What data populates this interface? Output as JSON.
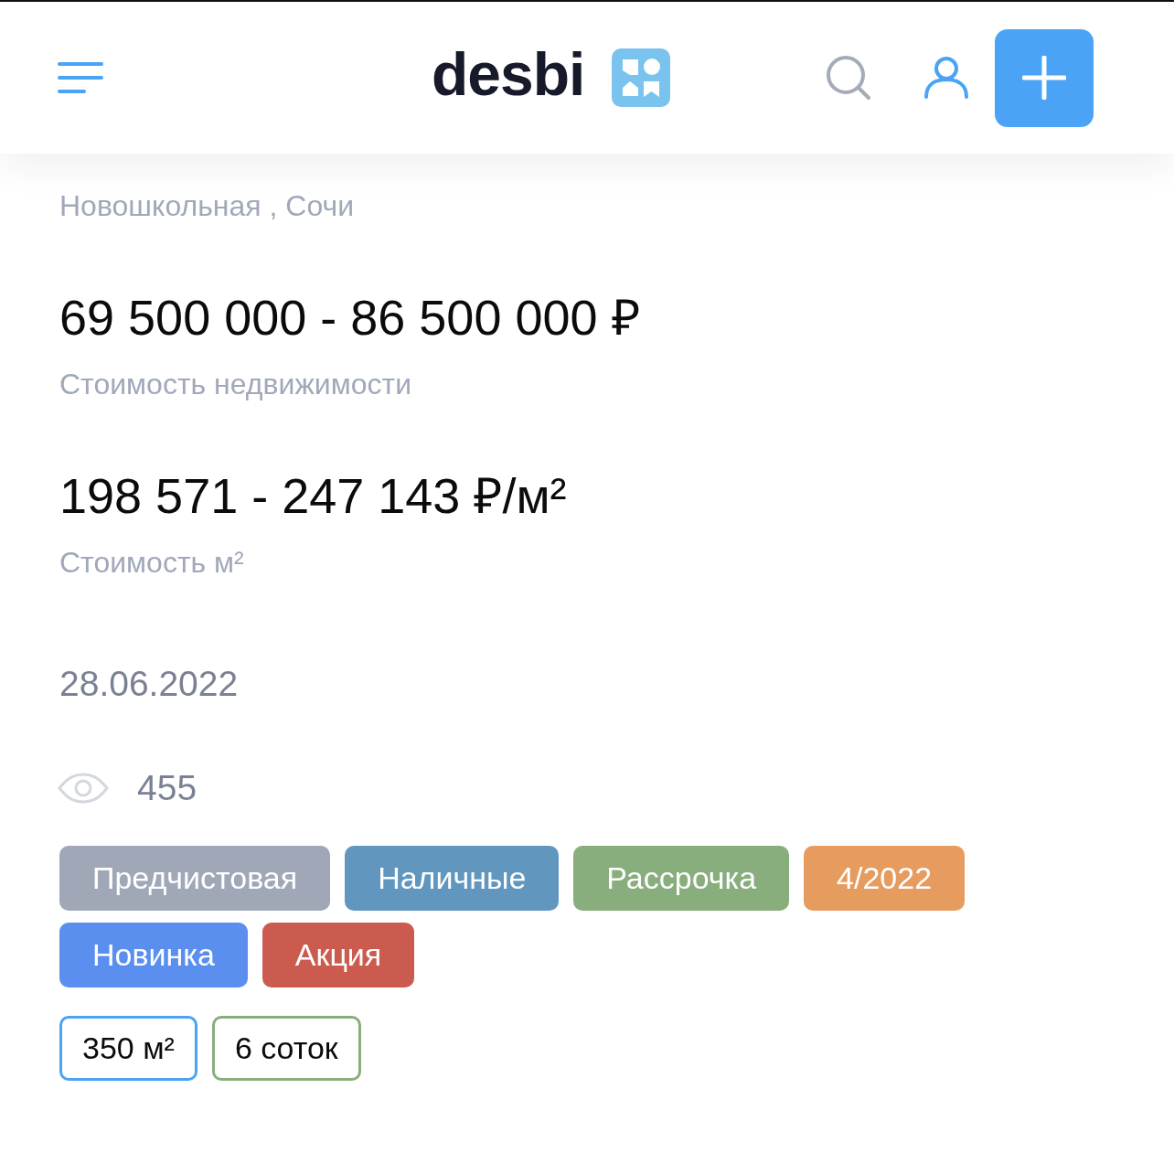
{
  "header": {
    "logo": "desbi"
  },
  "listing": {
    "address": "Новошкольная , Сочи",
    "price": "69 500 000 - 86 500 000 ₽",
    "price_label": "Стоимость недвижимости",
    "price_per_m2": "198 571 - 247 143 ₽/м²",
    "price_per_m2_label": "Стоимость м²",
    "date": "28.06.2022",
    "views": "455"
  },
  "tags": [
    {
      "label": "Предчистовая",
      "color": "#a0a8b8"
    },
    {
      "label": "Наличные",
      "color": "#6197bf"
    },
    {
      "label": "Рассрочка",
      "color": "#89ae7d"
    },
    {
      "label": "4/2022",
      "color": "#e69c5f"
    },
    {
      "label": "Новинка",
      "color": "#5a8ff0"
    },
    {
      "label": "Акция",
      "color": "#cb5b4f"
    }
  ],
  "specs": [
    {
      "label": "350 м²",
      "color": "#4aa3f5"
    },
    {
      "label": "6 соток",
      "color": "#89ae7d"
    }
  ]
}
